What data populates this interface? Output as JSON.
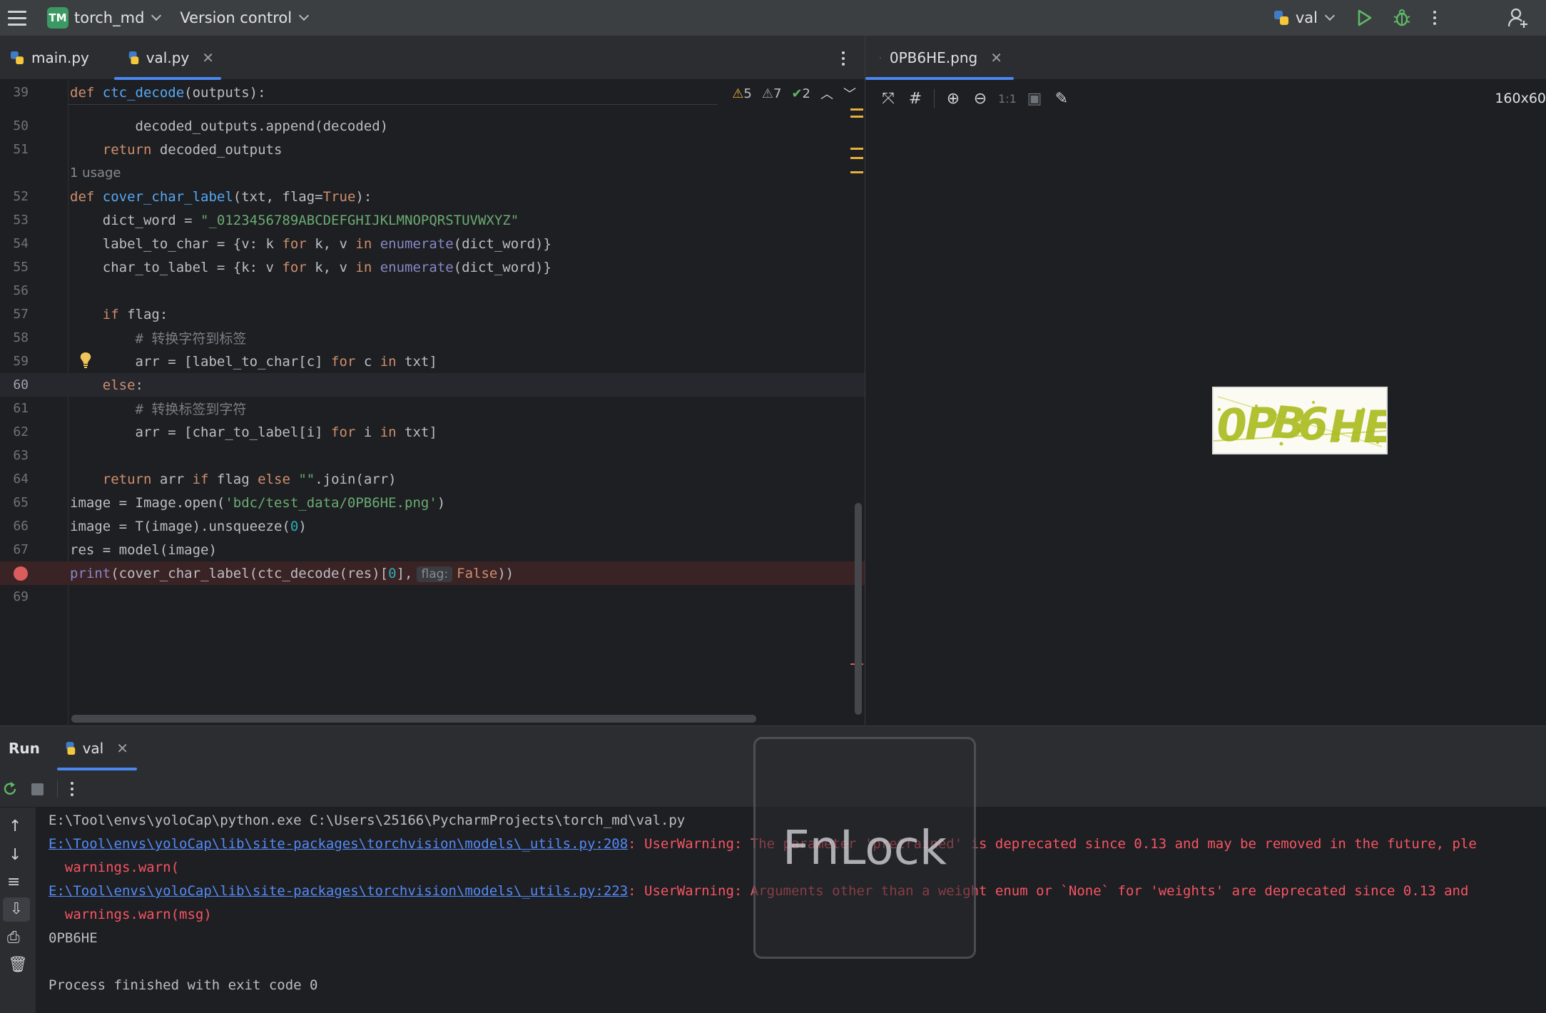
{
  "titlebar": {
    "project_badge": "TM",
    "project_name": "torch_md",
    "version_control": "Version control",
    "run_config": "val"
  },
  "left_tabs": [
    {
      "label": "main.py",
      "active": false
    },
    {
      "label": "val.py",
      "active": true
    }
  ],
  "right_tab": {
    "label": "0PB6HE.png"
  },
  "image_info": "160x60",
  "editor_status": {
    "warnings": "5",
    "weak_warnings": "7",
    "typos": "2"
  },
  "colors": {
    "accent": "#4a88f0",
    "badge": "#3b9a63",
    "error": "#f75464",
    "link": "#548af7"
  },
  "code": {
    "l39": {
      "num": "39",
      "kw": "def ",
      "fn": "ctc_decode",
      "rest": "(outputs):"
    },
    "l50": {
      "num": "50",
      "text": "        decoded_outputs.append(decoded)"
    },
    "l51": {
      "num": "51",
      "kw": "    return ",
      "rest": "decoded_outputs"
    },
    "usage": "1 usage",
    "l52": {
      "num": "52",
      "kw": "def ",
      "fn": "cover_char_label",
      "p1": "(txt, flag=",
      "kw2": "True",
      "p2": "):"
    },
    "l53": {
      "num": "53",
      "pre": "    dict_word = ",
      "str": "\"_0123456789ABCDEFGHIJKLMNOPQRSTUVWXYZ\""
    },
    "l54": {
      "num": "54",
      "a": "    label_to_char = {v: k ",
      "kw1": "for",
      "b": " k, v ",
      "kw2": "in",
      "bi": " enumerate",
      "c": "(dict_word)}"
    },
    "l55": {
      "num": "55",
      "a": "    char_to_label = {k: v ",
      "kw1": "for",
      "b": " k, v ",
      "kw2": "in",
      "bi": " enumerate",
      "c": "(dict_word)}"
    },
    "l56": {
      "num": "56"
    },
    "l57": {
      "num": "57",
      "kw": "    if ",
      "rest": "flag:"
    },
    "l58": {
      "num": "58",
      "cmt": "        # 转换字符到标签"
    },
    "l59": {
      "num": "59",
      "a": "        arr = [label_to_char[c] ",
      "kw1": "for",
      "b": " c ",
      "kw2": "in",
      "c": " txt]"
    },
    "l60": {
      "num": "60",
      "kw": "    else",
      "rest": ":"
    },
    "l61": {
      "num": "61",
      "cmt": "        # 转换标签到字符"
    },
    "l62": {
      "num": "62",
      "a": "        arr = [char_to_label[i] ",
      "kw1": "for",
      "b": " i ",
      "kw2": "in",
      "c": " txt]"
    },
    "l63": {
      "num": "63"
    },
    "l64": {
      "num": "64",
      "kw1": "    return",
      "a": " arr ",
      "kw2": "if",
      "b": " flag ",
      "kw3": "else",
      "str": " \"\"",
      "c": ".join(arr)"
    },
    "l65": {
      "num": "65",
      "a": "image = Image.open(",
      "str": "'bdc/test_data/0PB6HE.png'",
      "b": ")"
    },
    "l66": {
      "num": "66",
      "a": "image = T(image).unsqueeze(",
      "n": "0",
      "b": ")"
    },
    "l67": {
      "num": "67",
      "a": "res = model(image)"
    },
    "l68": {
      "bi": "print",
      "a": "(cover_char_label(ctc_decode(res)[",
      "n": "0",
      "b": "],",
      "hint": "flag:",
      "kw": "False",
      "c": "))"
    },
    "l69": {
      "num": "69"
    }
  },
  "run": {
    "title": "Run",
    "tab": "val",
    "lines": {
      "cmd": "E:\\Tool\\envs\\yoloCap\\python.exe C:\\Users\\25166\\PycharmProjects\\torch_md\\val.py",
      "link1": "E:\\Tool\\envs\\yoloCap\\lib\\site-packages\\torchvision\\models\\_utils.py:208",
      "err1": ": UserWarning: The parameter 'pretrained' is deprecated since 0.13 and may be removed in the future, ple",
      "warn1": "  warnings.warn(",
      "link2": "E:\\Tool\\envs\\yoloCap\\lib\\site-packages\\torchvision\\models\\_utils.py:223",
      "err2": ": UserWarning: Arguments other than a weight enum or `None` for 'weights' are deprecated since 0.13 and",
      "warn2": "  warnings.warn(msg)",
      "output": "0PB6HE",
      "finish": "Process finished with exit code 0"
    }
  },
  "overlay": {
    "text": "FnLock"
  }
}
